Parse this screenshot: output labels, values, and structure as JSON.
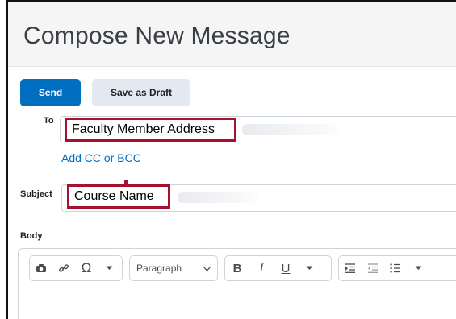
{
  "header": {
    "title": "Compose New Message"
  },
  "actions": {
    "send_label": "Send",
    "draft_label": "Save as Draft"
  },
  "to": {
    "label": "To",
    "value": "Faculty Member Address",
    "cc_link": "Add CC or BCC"
  },
  "subject": {
    "label": "Subject",
    "value": "Course Name"
  },
  "body": {
    "label": "Body",
    "toolbar": {
      "format_value": "Paragraph",
      "icons": [
        "image-icon",
        "link-icon",
        "omega-icon",
        "chevron-down-icon",
        "bold-icon",
        "italic-icon",
        "underline-icon",
        "indent-icon",
        "outdent-icon",
        "bullet-list-icon"
      ],
      "bold_glyph": "B",
      "italic_glyph": "I",
      "underline_glyph": "U",
      "omega_glyph": "Ω"
    }
  },
  "colors": {
    "primary": "#006fbf",
    "highlight": "#a5112f",
    "draft_bg": "#e3e9f1"
  }
}
